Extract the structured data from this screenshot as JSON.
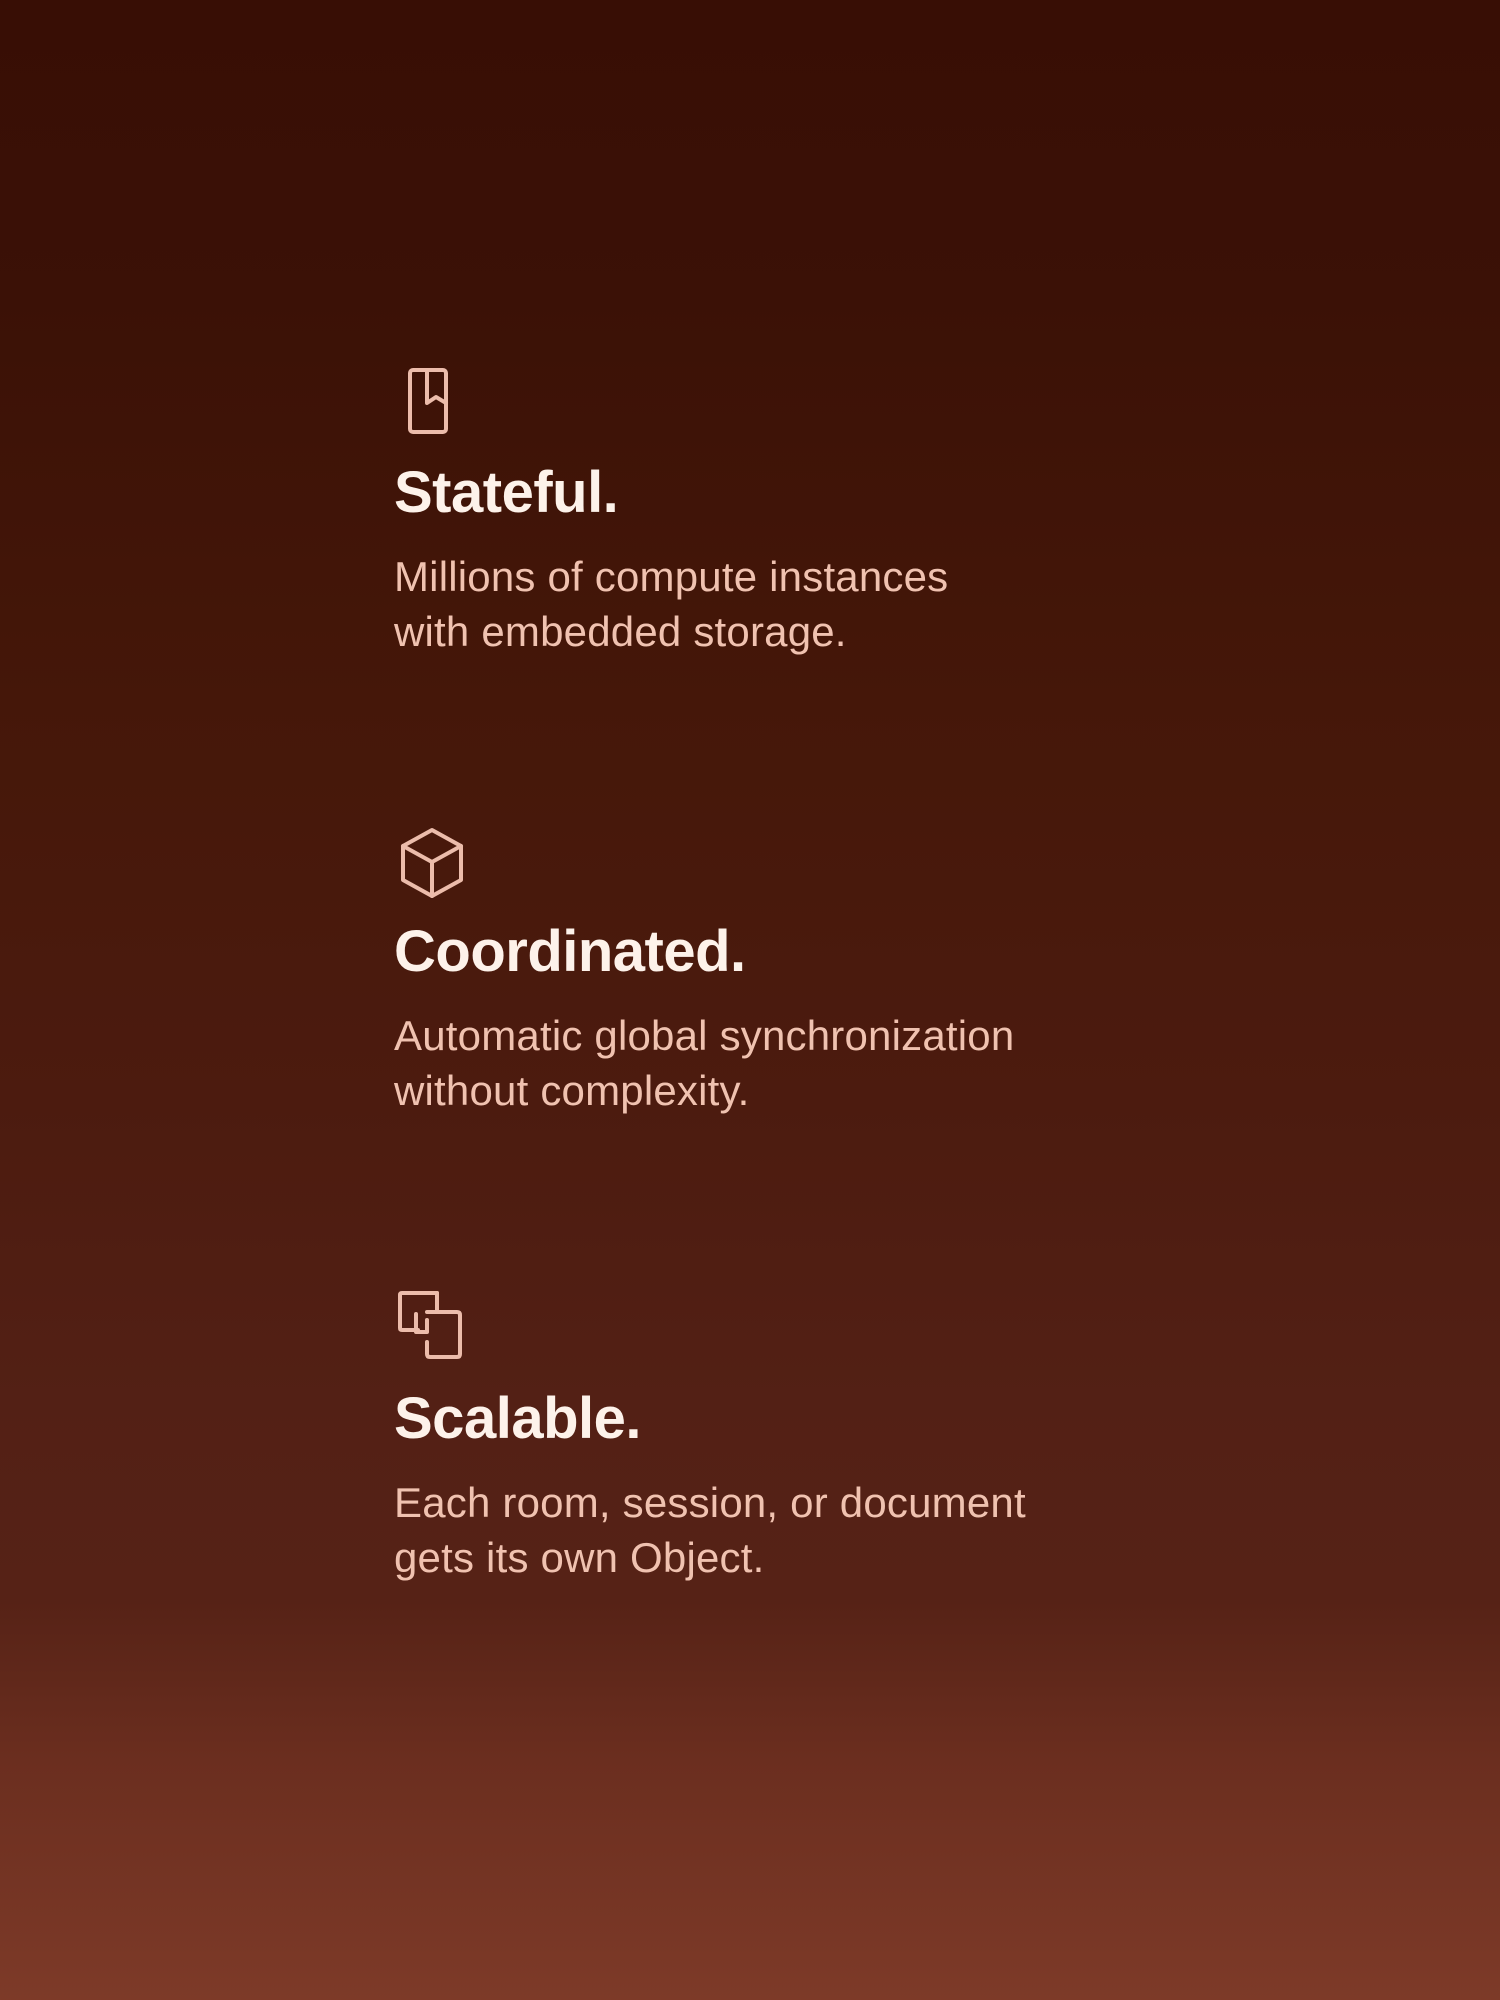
{
  "features": [
    {
      "icon": "bookmark-book-icon",
      "title": "Stateful.",
      "description_lines": [
        "Millions of compute instances",
        "with embedded storage."
      ]
    },
    {
      "icon": "cube-icon",
      "title": "Coordinated.",
      "description_lines": [
        "Automatic global synchronization",
        "without complexity."
      ]
    },
    {
      "icon": "overlapping-squares-icon",
      "title": "Scalable.",
      "description_lines": [
        "Each room, session, or document",
        "gets its own Object."
      ]
    }
  ],
  "colors": {
    "background_top": "#380e05",
    "background_bottom": "#7d3a28",
    "title": "#fdf2ea",
    "description": "#f0c2b0",
    "icon": "#ecbcab"
  }
}
